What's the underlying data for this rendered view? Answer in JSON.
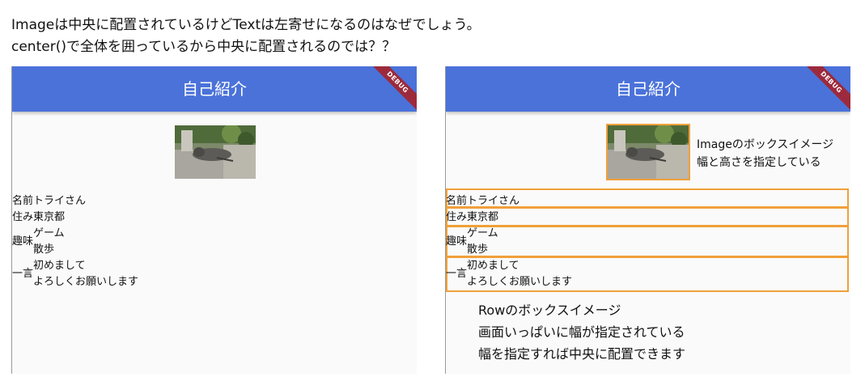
{
  "question": {
    "line1": "Imageは中央に配置されているけどTextは左寄せになるのはなぜでしょう。",
    "line2": "center()で全体を囲っているから中央に配置されるのでは？？"
  },
  "app": {
    "title": "自己紹介",
    "debug_label": "DEBUG"
  },
  "profile": {
    "name_label": "名前",
    "name_value": "トライさん",
    "address_label": "住み",
    "address_value": "東京都",
    "hobby_label": "趣味",
    "hobby_values": [
      "ゲーム",
      "散歩"
    ],
    "comment_label": "一言",
    "comment_values": [
      "初めまして",
      "よろしくお願いします"
    ]
  },
  "annotations": {
    "image_note_line1": "Imageのボックスイメージ",
    "image_note_line2": "幅と高さを指定している",
    "row_note_line1": "Rowのボックスイメージ",
    "row_note_line2": "画面いっぱいに幅が指定されている",
    "row_note_line3": "幅を指定すれば中央に配置できます"
  },
  "colors": {
    "appbar": "#4a72d9",
    "debug_banner": "#9c2a3c",
    "highlight_box": "#f0a03a"
  }
}
